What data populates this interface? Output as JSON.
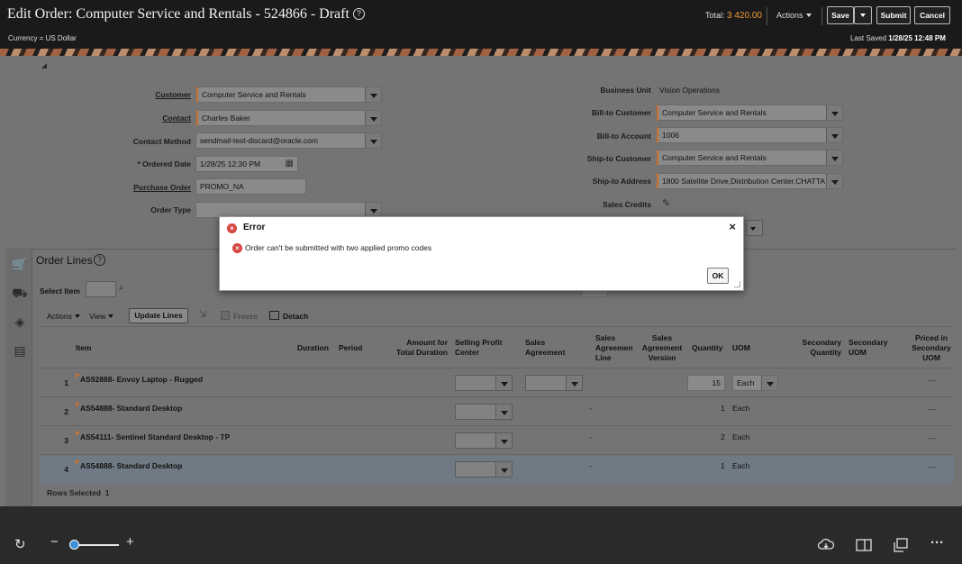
{
  "header": {
    "title": "Edit Order: Computer Service and Rentals - 524866 - Draft",
    "help": "?",
    "currency": "Currency = US Dollar",
    "total_label": "Total:",
    "total_value": "3 420.00",
    "actions": "Actions",
    "save": "Save",
    "submit": "Submit",
    "cancel": "Cancel",
    "last_saved_label": "Last Saved",
    "last_saved_value": "1/28/25 12:48 PM"
  },
  "form_left": {
    "customer_label": "Customer",
    "customer_value": "Computer Service and Rentals",
    "contact_label": "Contact",
    "contact_value": "Charles Baker",
    "contact_method_label": "Contact Method",
    "contact_method_value": "sendmail-test-discard@oracle.com",
    "ordered_date_label": "* Ordered Date",
    "ordered_date_value": "1/28/25 12:30 PM",
    "po_label": "Purchase Order",
    "po_value": "PROMO_NA",
    "order_type_label": "Order Type",
    "order_type_value": ""
  },
  "form_right": {
    "bu_label": "Business Unit",
    "bu_value": "Vision Operations",
    "bill_to_customer_label": "Bill-to Customer",
    "bill_to_customer_value": "Computer Service and Rentals",
    "bill_to_account_label": "Bill-to Account",
    "bill_to_account_value": "1006",
    "ship_to_customer_label": "Ship-to Customer",
    "ship_to_customer_value": "Computer Service and Rentals",
    "ship_to_address_label": "Ship-to Address",
    "ship_to_address_value": "1800 Satellite Drive,Distribution Center,CHATTA",
    "sales_credits_label": "Sales Credits"
  },
  "order_lines": {
    "title": "Order Lines",
    "select_item_label": "Select Item",
    "actions": "Actions",
    "view": "View",
    "update_lines": "Update Lines",
    "freeze": "Freeze",
    "detach": "Detach",
    "columns": {
      "item": "Item",
      "duration": "Duration",
      "period": "Period",
      "amount1": "Amount for",
      "amount2": "Total Duration",
      "spc1": "Selling Profit",
      "spc2": "Center",
      "sa1": "Sales",
      "sa2": "Agreement",
      "sal1": "Sales",
      "sal2": "Agreemen",
      "sal3": "Line",
      "sav1": "Sales",
      "sav2": "Agreement",
      "sav3": "Version",
      "qty": "Quantity",
      "uom": "UOM",
      "sq1": "Secondary",
      "sq2": "Quantity",
      "su1": "Secondary",
      "su2": "UOM",
      "pi1": "Priced in",
      "pi2": "Secondary",
      "pi3": "UOM"
    },
    "rows": [
      {
        "num": "1",
        "item": "AS92888- Envoy Laptop - Rugged",
        "qty": "15",
        "uom": "Each",
        "dash": "—"
      },
      {
        "num": "2",
        "item": "AS54888- Standard Desktop",
        "sal": "-",
        "qty": "1",
        "uom": "Each",
        "dash": "—"
      },
      {
        "num": "3",
        "item": "AS54111- Sentinel Standard Desktop - TP",
        "sal": "-",
        "qty": "2",
        "uom": "Each",
        "dash": "—"
      },
      {
        "num": "4",
        "item": "AS54888- Standard Desktop",
        "sal": "-",
        "qty": "1",
        "uom": "Each",
        "dash": "—"
      }
    ],
    "rows_selected_label": "Rows Selected",
    "rows_selected_value": "1"
  },
  "dialog": {
    "title": "Error",
    "message": "Order can't be submitted with two applied promo codes",
    "ok": "OK",
    "close": "×"
  },
  "icons": {
    "refresh": "↻",
    "minus": "−",
    "plus": "+",
    "more": "···"
  }
}
